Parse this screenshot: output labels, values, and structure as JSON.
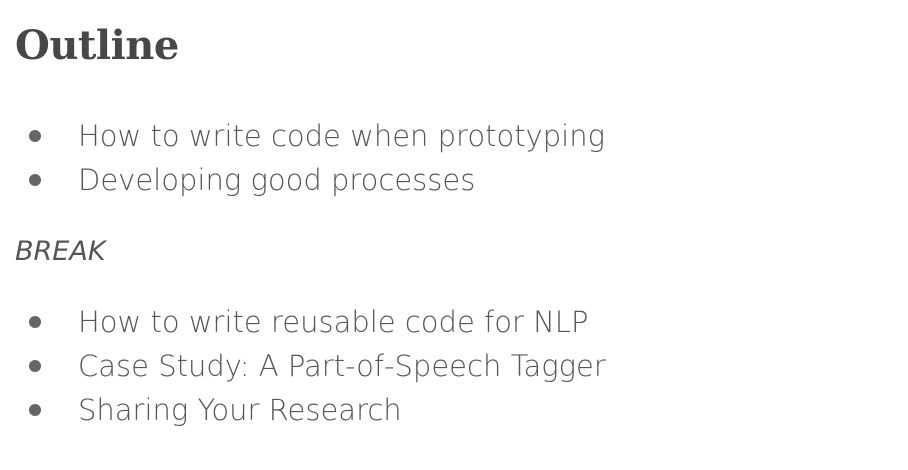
{
  "slide": {
    "title": "Outline",
    "section1": [
      "How to write code when prototyping",
      "Developing good processes"
    ],
    "break_label": "BREAK",
    "section2": [
      "How to write reusable code for NLP",
      "Case Study: A Part-of-Speech Tagger",
      "Sharing Your Research"
    ]
  }
}
